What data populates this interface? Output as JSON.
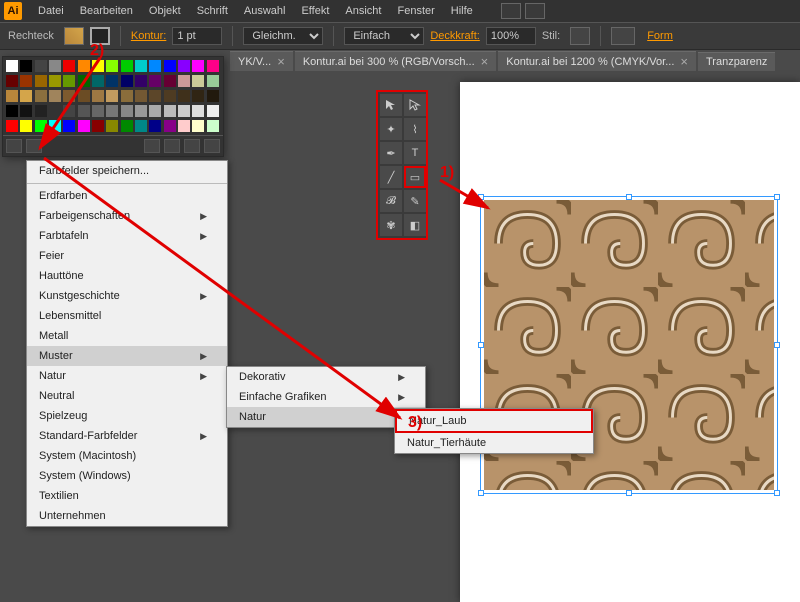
{
  "app": {
    "short": "Ai"
  },
  "menubar": [
    "Datei",
    "Bearbeiten",
    "Objekt",
    "Schrift",
    "Auswahl",
    "Effekt",
    "Ansicht",
    "Fenster",
    "Hilfe"
  ],
  "toolbar": {
    "shape_label": "Rechteck",
    "stroke_label": "Kontur:",
    "stroke_value": "1 pt",
    "dash_value": "Gleichm.",
    "profile_value": "Einfach",
    "opacity_label": "Deckkraft:",
    "opacity_value": "100%",
    "style_label": "Stil:",
    "format_label": "Form"
  },
  "tabs": [
    {
      "label": "YK/V...",
      "close": "×"
    },
    {
      "label": "Kontur.ai bei 300 % (RGB/Vorsch...",
      "close": "×"
    },
    {
      "label": "Kontur.ai bei 1200 % (CMYK/Vor...",
      "close": "×"
    },
    {
      "label": "Tranzparenz"
    }
  ],
  "swatches": {
    "menu_library_save": "Farbfelder speichern..."
  },
  "context_menu1": [
    {
      "label": "Erdfarben"
    },
    {
      "label": "Farbeigenschaften",
      "submenu": true
    },
    {
      "label": "Farbtafeln",
      "submenu": true
    },
    {
      "label": "Feier"
    },
    {
      "label": "Hauttöne"
    },
    {
      "label": "Kunstgeschichte",
      "submenu": true
    },
    {
      "label": "Lebensmittel"
    },
    {
      "label": "Metall"
    },
    {
      "label": "Muster",
      "submenu": true,
      "hover": true
    },
    {
      "label": "Natur",
      "submenu": true
    },
    {
      "label": "Neutral"
    },
    {
      "label": "Spielzeug"
    },
    {
      "label": "Standard-Farbfelder",
      "submenu": true
    },
    {
      "label": "System (Macintosh)"
    },
    {
      "label": "System (Windows)"
    },
    {
      "label": "Textilien"
    },
    {
      "label": "Unternehmen"
    }
  ],
  "context_menu2": [
    {
      "label": "Dekorativ",
      "submenu": true
    },
    {
      "label": "Einfache Grafiken",
      "submenu": true
    },
    {
      "label": "Natur",
      "submenu": true,
      "hover": true
    }
  ],
  "context_menu3": [
    {
      "label": "Natur_Laub",
      "highlight": true
    },
    {
      "label": "Natur_Tierhäute"
    }
  ],
  "annotations": {
    "a1": "1)",
    "a2": "2)",
    "a3": "3)"
  },
  "swatch_colors_row1": [
    "#fff",
    "#000",
    "#444",
    "#888",
    "#e00",
    "#f80",
    "#ff0",
    "#8f0",
    "#0c0",
    "#0cc",
    "#08f",
    "#00f",
    "#80f",
    "#f0f",
    "#f08"
  ],
  "swatch_colors_row2": [
    "#600",
    "#930",
    "#960",
    "#990",
    "#690",
    "#060",
    "#066",
    "#036",
    "#006",
    "#306",
    "#606",
    "#603",
    "#c99",
    "#cc9",
    "#9c9"
  ],
  "swatch_colors_row3": [
    "#b8863b",
    "#d4a54a",
    "#8b6f3e",
    "#a0845c",
    "#7d5a2e",
    "#6b4c24",
    "#9e7843",
    "#c29b5f",
    "#8a6d3b",
    "#735833",
    "#5c4629",
    "#4e3b22",
    "#3f301b",
    "#302514",
    "#21190d"
  ],
  "swatch_colors_row4": [
    "#000",
    "#111",
    "#222",
    "#333",
    "#444",
    "#555",
    "#666",
    "#777",
    "#888",
    "#999",
    "#aaa",
    "#bbb",
    "#ccc",
    "#ddd",
    "#eee"
  ],
  "swatch_colors_row5": [
    "#f00",
    "#ff0",
    "#0f0",
    "#0ff",
    "#00f",
    "#f0f",
    "#800",
    "#880",
    "#080",
    "#088",
    "#008",
    "#808",
    "#fcc",
    "#ffc",
    "#cfc"
  ]
}
